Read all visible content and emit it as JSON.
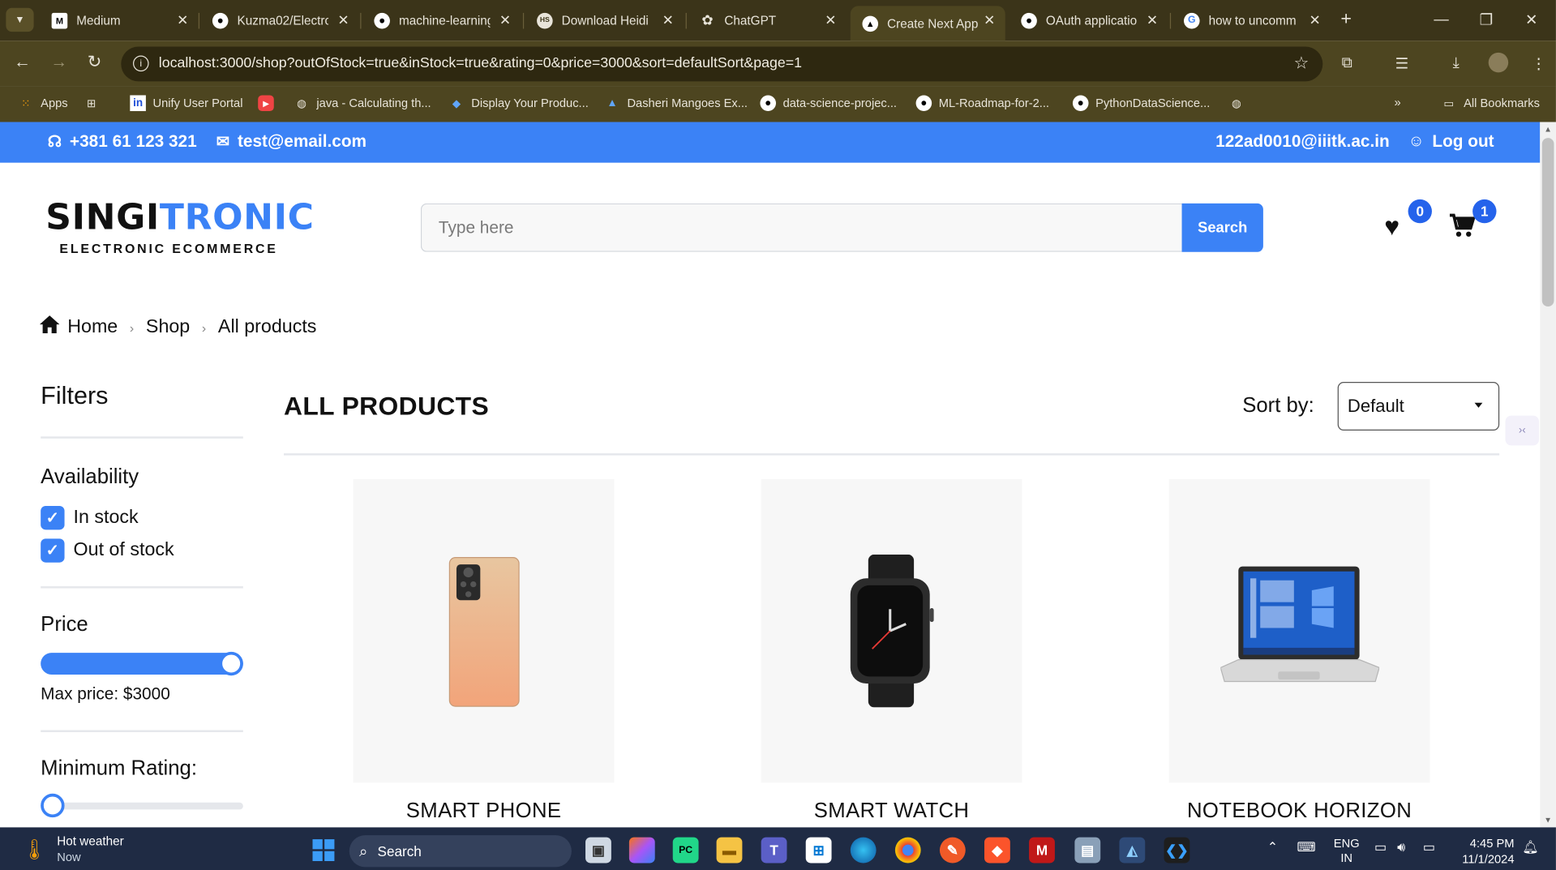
{
  "browser": {
    "tabs": [
      {
        "title": "Medium",
        "favicon": "M"
      },
      {
        "title": "Kuzma02/Electro",
        "favicon": "github"
      },
      {
        "title": "machine-learning",
        "favicon": "github"
      },
      {
        "title": "Download Heidi",
        "favicon": "HS"
      },
      {
        "title": "ChatGPT",
        "favicon": "chatgpt"
      },
      {
        "title": "Create Next App",
        "favicon": "next"
      },
      {
        "title": "OAuth applicatio",
        "favicon": "github"
      },
      {
        "title": "how to uncomm",
        "favicon": "google"
      }
    ],
    "url": "localhost:3000/shop?outOfStock=true&inStock=true&rating=0&price=3000&sort=defaultSort&page=1",
    "bookmarks": [
      {
        "label": "Apps"
      },
      {
        "label": "Unify User Portal"
      },
      {
        "label": "java - Calculating th..."
      },
      {
        "label": "Display Your Produc..."
      },
      {
        "label": "Dasheri Mangoes Ex..."
      },
      {
        "label": "data-science-projec..."
      },
      {
        "label": "ML-Roadmap-for-2..."
      },
      {
        "label": "PythonDataScience..."
      }
    ],
    "all_bookmarks": "All Bookmarks"
  },
  "topbar": {
    "phone": "+381 61 123 321",
    "email": "test@email.com",
    "user_email": "122ad0010@iiitk.ac.in",
    "logout": "Log out"
  },
  "header": {
    "logo_part1": "SINGI",
    "logo_part2": "TRONIC",
    "logo_tagline": "ELECTRONIC ECOMMERCE",
    "search_placeholder": "Type here",
    "search_button": "Search",
    "wishlist_count": "0",
    "cart_count": "1"
  },
  "breadcrumb": [
    "Home",
    "Shop",
    "All products"
  ],
  "filters": {
    "title": "Filters",
    "availability_title": "Availability",
    "in_stock": "In stock",
    "out_of_stock": "Out of stock",
    "price_title": "Price",
    "max_price_label": "Max price: $3000",
    "price_fraction": 1.0,
    "rating_title": "Minimum Rating:",
    "rating_fraction": 0.0
  },
  "products": {
    "title": "ALL PRODUCTS",
    "sort_label": "Sort by:",
    "sort_value": "Default",
    "items": [
      {
        "name": "SMART PHONE"
      },
      {
        "name": "SMART WATCH"
      },
      {
        "name": "NOTEBOOK HORIZON"
      }
    ]
  },
  "taskbar": {
    "weather_title": "Hot weather",
    "weather_sub": "Now",
    "search": "Search",
    "lang1": "ENG",
    "lang2": "IN",
    "time": "4:45 PM",
    "date": "11/1/2024"
  },
  "colors": {
    "accent": "#3b82f6",
    "tabbar": "#3b3419",
    "taskbar": "#1f2b44"
  }
}
